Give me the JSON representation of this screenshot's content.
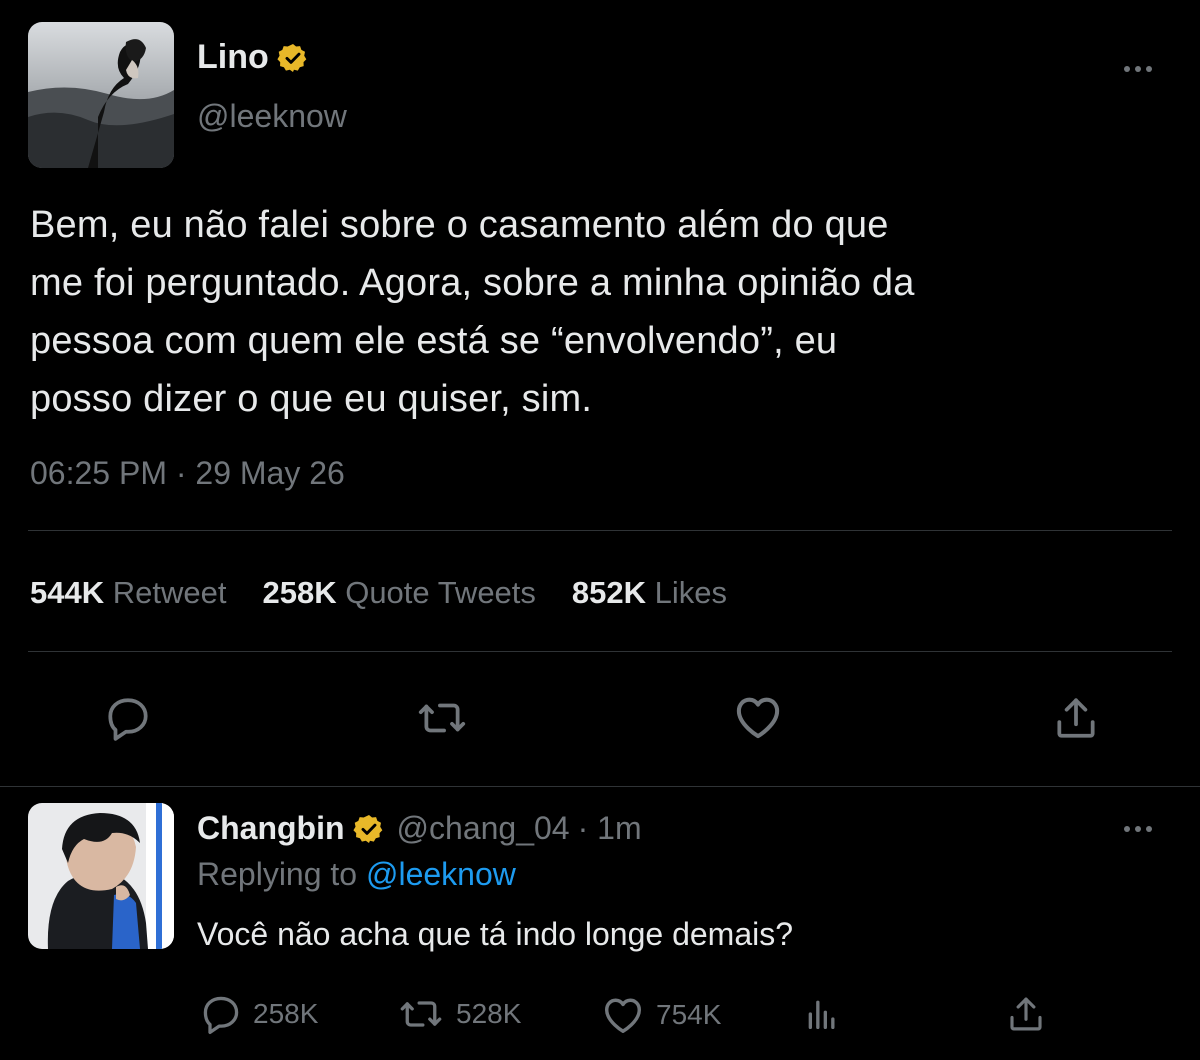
{
  "main_tweet": {
    "author_name": "Lino",
    "handle": "@leeknow",
    "text_lines": [
      "Bem, eu não falei sobre o casamento além do que",
      "me foi perguntado. Agora, sobre a minha opinião da",
      "pessoa com quem ele está se “envolvendo”, eu",
      "posso dizer o que eu quiser, sim."
    ],
    "timestamp": "06:25 PM · 29 May 26",
    "stats": {
      "retweets_count": "544K",
      "retweets_label": "Retweet",
      "quotes_count": "258K",
      "quotes_label": "Quote Tweets",
      "likes_count": "852K",
      "likes_label": "Likes"
    },
    "actions": [
      "reply-icon",
      "retweet-icon",
      "like-icon",
      "share-icon"
    ]
  },
  "reply_tweet": {
    "author_name": "Changbin",
    "handle": "@chang_04",
    "time": "· 1m",
    "replying_prefix": "Replying to",
    "replying_handle": "@leeknow",
    "text": "Você não acha que tá indo longe demais?",
    "stats": {
      "replies": "258K",
      "retweets": "528K",
      "likes": "754K"
    }
  },
  "colors": {
    "background": "#000000",
    "text": "#e7e9ea",
    "muted": "#71767b",
    "link": "#1d9bf0",
    "verified_gold": "#e8b829",
    "divider": "#2f3336"
  }
}
